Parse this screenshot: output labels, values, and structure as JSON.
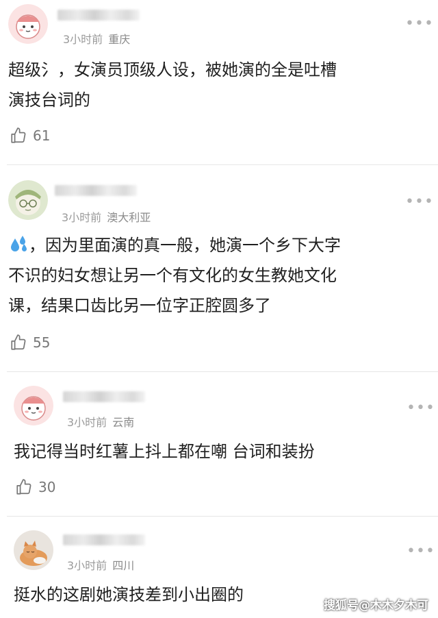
{
  "comments": [
    {
      "time": "3小时前",
      "location": "重庆",
      "lines": [
        "超级氵，女演员顶级人设，被她演的全是吐槽",
        "演技台词的"
      ],
      "likes": "61"
    },
    {
      "time": "3小时前",
      "location": "澳大利亚",
      "emoji": "sweat-droplets-icon",
      "lines": [
        "，因为里面演的真一般，她演一个乡下大字",
        "不识的妇女想让另一个有文化的女生教她文化",
        "课，结果口齿比另一位字正腔圆多了"
      ],
      "likes": "55"
    },
    {
      "time": "3小时前",
      "location": "云南",
      "lines": [
        "我记得当时红薯上抖上都在嘲 台词和装扮"
      ],
      "likes": "30"
    },
    {
      "time": "3小时前",
      "location": "四川",
      "lines": [
        "挺水的这剧她演技差到小出圈的"
      ],
      "likes": ""
    }
  ],
  "more_label": "•••",
  "watermark": "搜狐号@木木夕木可",
  "colors": {
    "meta": "#9a9a9a",
    "text": "#1f1f1f",
    "divider": "#e6e6e6"
  }
}
